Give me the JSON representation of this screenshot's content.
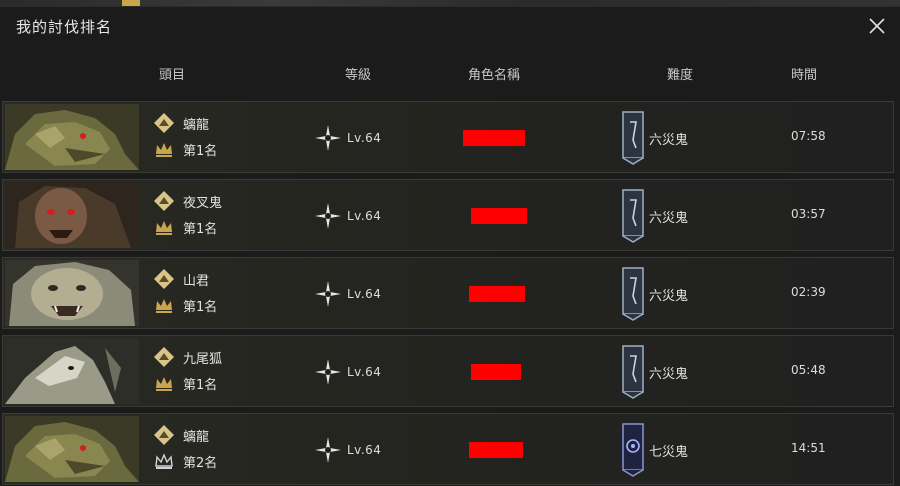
{
  "window": {
    "title": "我的討伐排名"
  },
  "columns": {
    "boss": "頭目",
    "level": "等級",
    "character_name": "角色名稱",
    "difficulty": "難度",
    "time": "時間"
  },
  "rows": [
    {
      "boss_name": "螭龍",
      "rank": "第1名",
      "level": "Lv.64",
      "difficulty": "六災鬼",
      "time": "07:58",
      "portrait": "dragon-portrait",
      "rank_icon": "crown-gold-icon",
      "difficulty_icon": "banner-six-icon"
    },
    {
      "boss_name": "夜叉鬼",
      "rank": "第1名",
      "level": "Lv.64",
      "difficulty": "六災鬼",
      "time": "03:57",
      "portrait": "yaksha-portrait",
      "rank_icon": "crown-gold-icon",
      "difficulty_icon": "banner-six-icon"
    },
    {
      "boss_name": "山君",
      "rank": "第1名",
      "level": "Lv.64",
      "difficulty": "六災鬼",
      "time": "02:39",
      "portrait": "tiger-portrait",
      "rank_icon": "crown-gold-icon",
      "difficulty_icon": "banner-six-icon"
    },
    {
      "boss_name": "九尾狐",
      "rank": "第1名",
      "level": "Lv.64",
      "difficulty": "六災鬼",
      "time": "05:48",
      "portrait": "fox-portrait",
      "rank_icon": "crown-gold-icon",
      "difficulty_icon": "banner-six-icon"
    },
    {
      "boss_name": "螭龍",
      "rank": "第2名",
      "level": "Lv.64",
      "difficulty": "七災鬼",
      "time": "14:51",
      "portrait": "dragon-portrait",
      "rank_icon": "crown-silver-icon",
      "difficulty_icon": "banner-seven-icon"
    }
  ]
}
